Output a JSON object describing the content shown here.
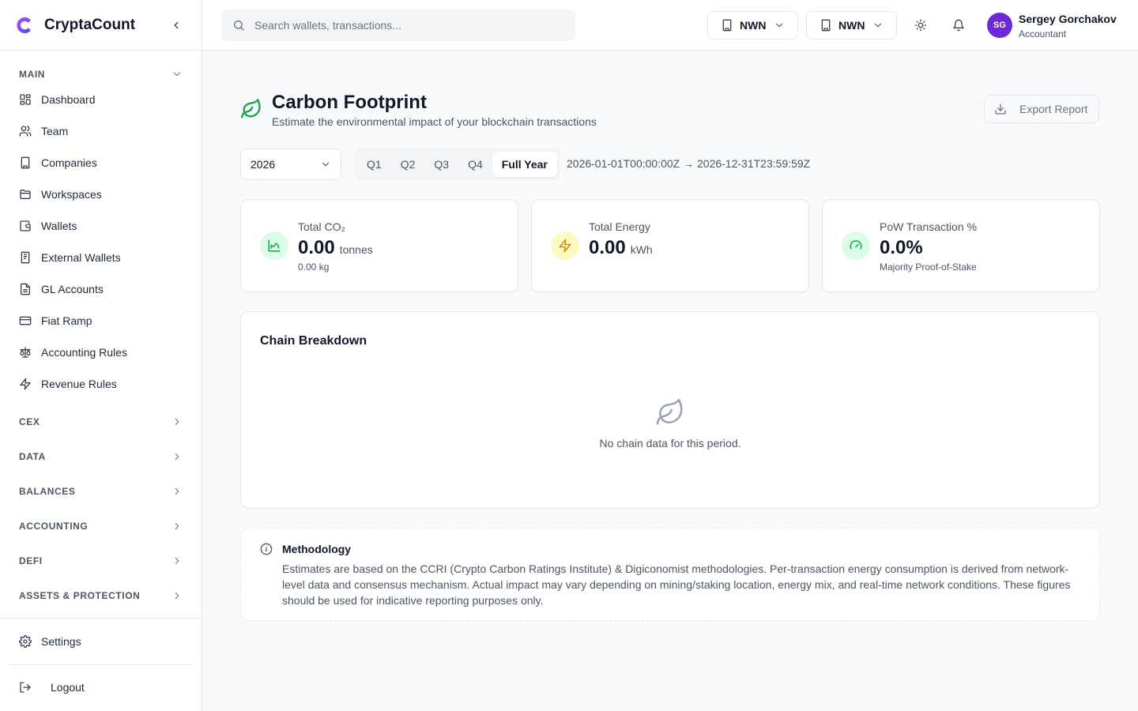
{
  "app": {
    "name": "CryptaCount"
  },
  "sidebar": {
    "main_label": "MAIN",
    "items": [
      {
        "label": "Dashboard",
        "icon": "dashboard-icon"
      },
      {
        "label": "Team",
        "icon": "users-icon"
      },
      {
        "label": "Companies",
        "icon": "building-icon"
      },
      {
        "label": "Workspaces",
        "icon": "folder-icon"
      },
      {
        "label": "Wallets",
        "icon": "wallet-icon"
      },
      {
        "label": "External Wallets",
        "icon": "book-icon"
      },
      {
        "label": "GL Accounts",
        "icon": "file-text-icon"
      },
      {
        "label": "Fiat Ramp",
        "icon": "credit-card-icon"
      },
      {
        "label": "Accounting Rules",
        "icon": "scale-icon"
      },
      {
        "label": "Revenue Rules",
        "icon": "zap-icon"
      }
    ],
    "sections": [
      "CEX",
      "DATA",
      "BALANCES",
      "ACCOUNTING",
      "DEFI",
      "ASSETS & PROTECTION"
    ],
    "settings_label": "Settings",
    "logout_label": "Logout"
  },
  "topbar": {
    "search_placeholder": "Search wallets, transactions...",
    "entity1": "NWN",
    "entity2": "NWN",
    "user": {
      "initials": "SG",
      "name": "Sergey Gorchakov",
      "role": "Accountant"
    }
  },
  "page": {
    "title": "Carbon Footprint",
    "subtitle": "Estimate the environmental impact of your blockchain transactions",
    "export_label": "Export Report",
    "year": "2026",
    "quarters": [
      "Q1",
      "Q2",
      "Q3",
      "Q4",
      "Full Year"
    ],
    "active_period": "Full Year",
    "range": "2026-01-01T00:00:00Z → 2026-12-31T23:59:59Z"
  },
  "stats": [
    {
      "label": "Total CO₂",
      "value": "0.00",
      "unit": "tonnes",
      "sub": "0.00 kg",
      "icon": "chart-icon",
      "color": "#16a34a",
      "bg": "#dcfce7"
    },
    {
      "label": "Total Energy",
      "value": "0.00",
      "unit": "kWh",
      "sub": "",
      "icon": "zap-icon",
      "color": "#ca8a04",
      "bg": "#fef9c3"
    },
    {
      "label": "PoW Transaction %",
      "value": "0.0%",
      "unit": "",
      "sub": "Majority Proof-of-Stake",
      "icon": "gauge-icon",
      "color": "#16a34a",
      "bg": "#dcfce7"
    }
  ],
  "breakdown": {
    "title": "Chain Breakdown",
    "empty_text": "No chain data for this period."
  },
  "methodology": {
    "title": "Methodology",
    "text": "Estimates are based on the CCRI (Crypto Carbon Ratings Institute) & Digiconomist methodologies. Per-transaction energy consumption is derived from network-level data and consensus mechanism. Actual impact may vary depending on mining/staking location, energy mix, and real-time network conditions. These figures should be used for indicative reporting purposes only."
  }
}
